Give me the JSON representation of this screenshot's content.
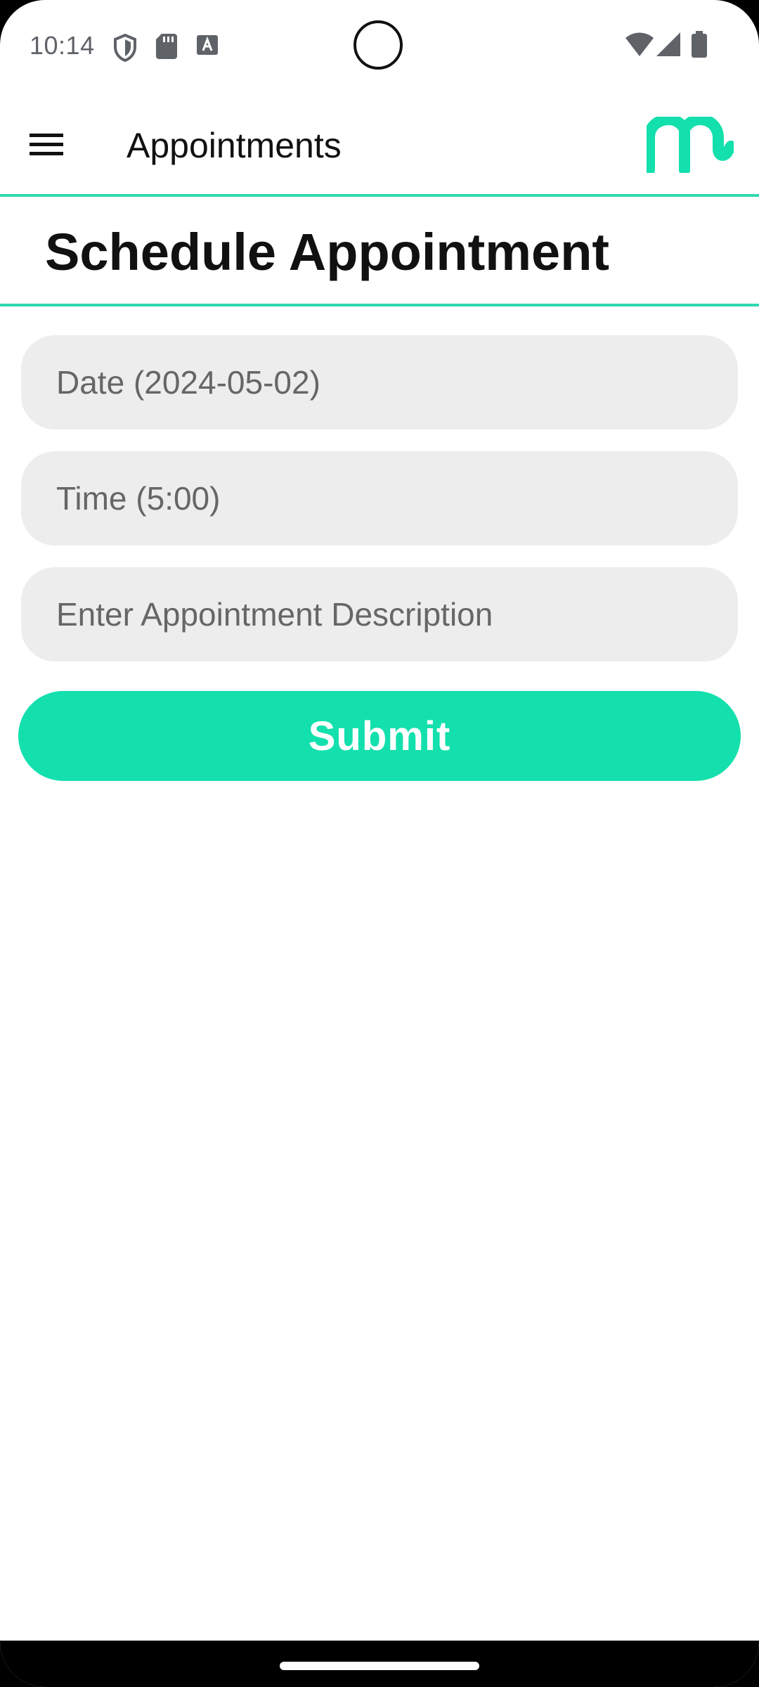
{
  "status_bar": {
    "time": "10:14",
    "icons": [
      "shield-icon",
      "sd-card-icon",
      "keyboard-a-icon",
      "wifi-icon",
      "signal-icon",
      "battery-icon"
    ]
  },
  "app_bar": {
    "title": "Appointments",
    "menu_icon": "hamburger-menu-icon",
    "logo_icon": "elephant-logo-icon"
  },
  "form": {
    "heading": "Schedule Appointment",
    "date_placeholder": "Date (2024-05-02)",
    "time_placeholder": "Time (5:00)",
    "description_placeholder": "Enter Appointment Description",
    "submit_label": "Submit"
  },
  "colors": {
    "accent": "#13e0ad",
    "divider": "#2fd9b0",
    "field_background": "#ededed"
  }
}
